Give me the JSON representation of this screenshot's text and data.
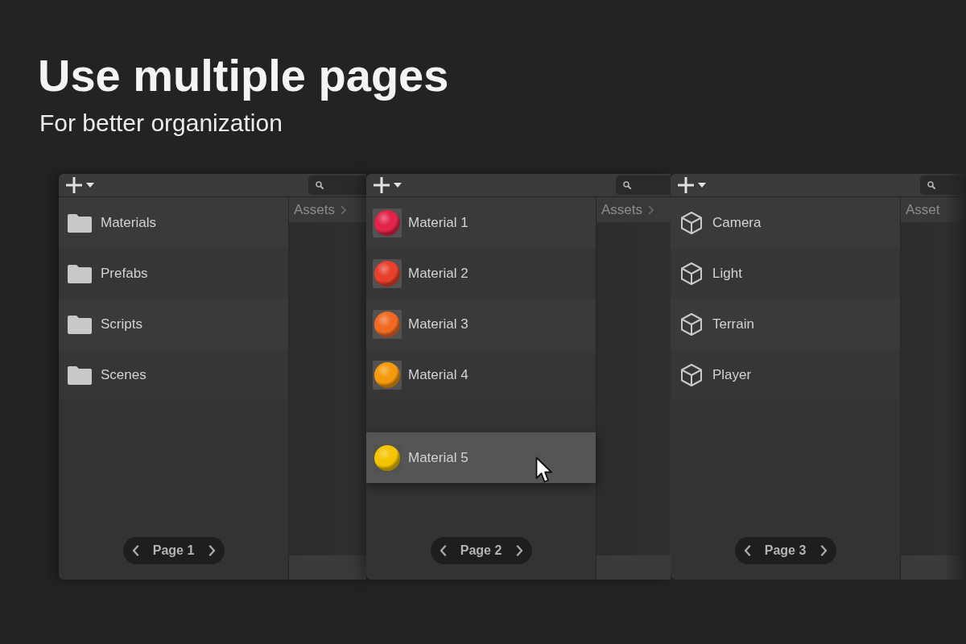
{
  "title": "Use multiple pages",
  "subtitle": "For better organization",
  "panels": [
    {
      "breadcrumb": {
        "label": "Assets",
        "separator": true
      },
      "items": [
        {
          "kind": "folder",
          "label": "Materials"
        },
        {
          "kind": "folder",
          "label": "Prefabs"
        },
        {
          "kind": "folder",
          "label": "Scripts"
        },
        {
          "kind": "folder",
          "label": "Scenes"
        }
      ],
      "pager": {
        "label": "Page 1"
      }
    },
    {
      "breadcrumb": {
        "label": "Assets",
        "separator": true
      },
      "items": [
        {
          "kind": "material",
          "label": "Material 1",
          "color": "#e3244a",
          "dragging": false
        },
        {
          "kind": "material",
          "label": "Material 2",
          "color": "#e8402c",
          "dragging": false
        },
        {
          "kind": "material",
          "label": "Material 3",
          "color": "#f06a22",
          "dragging": false
        },
        {
          "kind": "material",
          "label": "Material 4",
          "color": "#f59a0c",
          "dragging": false
        },
        {
          "kind": "material",
          "label": "Material 5",
          "color": "#f5c400",
          "dragging": true
        }
      ],
      "pager": {
        "label": "Page 2"
      }
    },
    {
      "breadcrumb": {
        "label": "Asset",
        "separator": false
      },
      "items": [
        {
          "kind": "object",
          "label": "Camera"
        },
        {
          "kind": "object",
          "label": "Light"
        },
        {
          "kind": "object",
          "label": "Terrain"
        },
        {
          "kind": "object",
          "label": "Player"
        }
      ],
      "pager": {
        "label": "Page 3"
      }
    }
  ]
}
